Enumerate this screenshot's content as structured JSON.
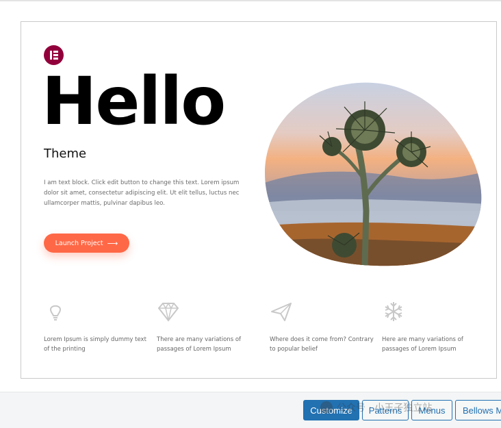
{
  "hero": {
    "title": "Hello",
    "subtitle": "Theme",
    "body": "I am text block. Click edit button to change this text. Lorem ipsum dolor sit amet, consectetur adipiscing elit. Ut elit tellus, luctus nec ullamcorper mattis, pulvinar dapibus leo.",
    "button_label": "Launch Project",
    "button_icon": "arrow-right-icon",
    "logo_icon": "elementor-logo-icon",
    "image_subject": "thistle-plant-at-sunset-photo"
  },
  "features": [
    {
      "icon": "lightbulb-icon",
      "text": "Lorem Ipsum is simply dummy text of the printing"
    },
    {
      "icon": "diamond-icon",
      "text": "There are many variations of passages of Lorem Ipsum"
    },
    {
      "icon": "paper-plane-icon",
      "text": "Where does it come from? Contrary to popular belief"
    },
    {
      "icon": "snowflake-icon",
      "text": "Here are many variations of passages of Lorem Ipsum"
    }
  ],
  "actions": {
    "customize": "Customize",
    "patterns": "Patterns",
    "menus": "Menus",
    "bellows": "Bellows M"
  },
  "watermark": {
    "text": "公众号 · 小王子独立站"
  },
  "colors": {
    "accent_button": "#ff6846",
    "logo": "#92003b",
    "wp_primary": "#2271b1",
    "feature_icon": "#c8c8c8"
  }
}
